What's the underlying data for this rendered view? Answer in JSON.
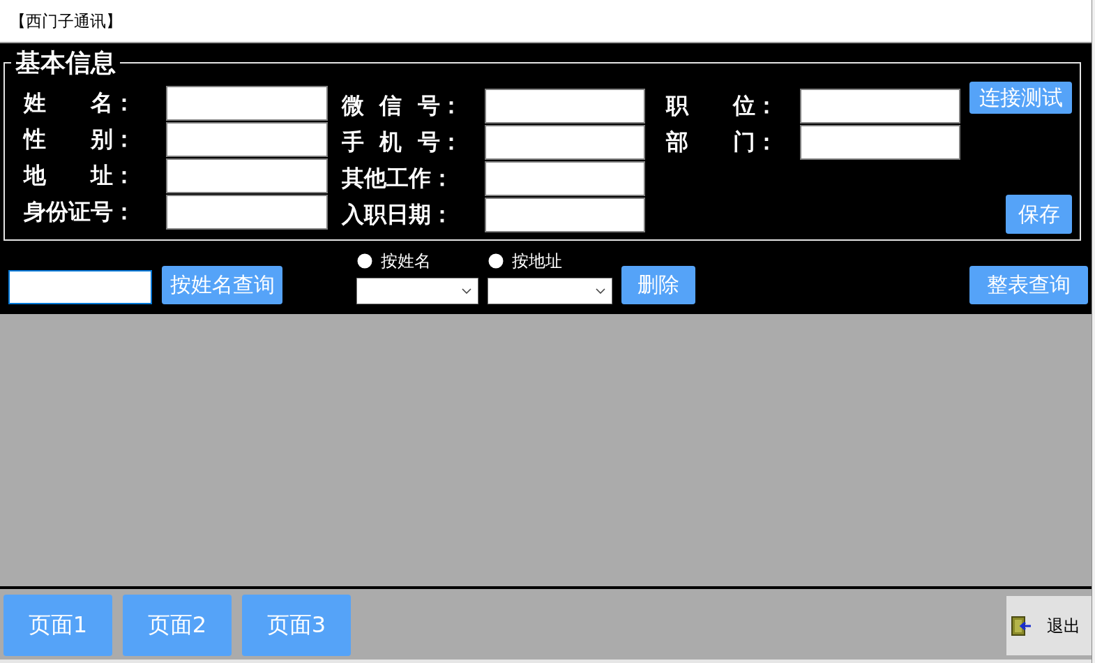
{
  "window": {
    "title": "【西门子通讯】"
  },
  "basic_info": {
    "title": "基本信息",
    "field_columns": [
      {
        "fields": [
          {
            "label": "姓　　名："
          },
          {
            "label": "性　　别："
          },
          {
            "label": "地　　址："
          },
          {
            "label": "身份证号："
          }
        ]
      },
      {
        "fields": [
          {
            "label": "微  信  号："
          },
          {
            "label": "手  机  号："
          },
          {
            "label": "其他工作："
          },
          {
            "label": "入职日期："
          }
        ]
      },
      {
        "fields": [
          {
            "label": "职　　位："
          },
          {
            "label": "部　　门："
          }
        ]
      }
    ],
    "connect_button": "连接测试",
    "save_button": "保存"
  },
  "query_bar": {
    "search_field": {
      "focused": true
    },
    "name_query_button": "按姓名查询",
    "options": [
      {
        "label": "按姓名",
        "selected": false
      },
      {
        "label": "按地址",
        "selected": false
      }
    ],
    "delete_button": "删除",
    "full_query_button": "整表查询"
  },
  "page_buttons": [
    {
      "label": "页面1"
    },
    {
      "label": "页面2"
    },
    {
      "label": "页面3"
    }
  ],
  "exit_button": "退出"
}
